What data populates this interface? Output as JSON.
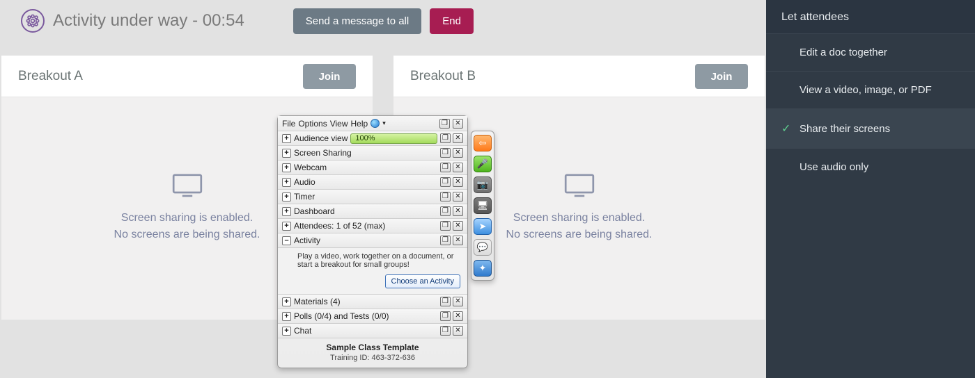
{
  "header": {
    "title": "Activity under way - 00:54",
    "send_all": "Send a message to all",
    "end": "End"
  },
  "breakouts": [
    {
      "name": "Breakout A",
      "join": "Join",
      "line1": "Screen sharing is enabled.",
      "line2": "No screens are being shared."
    },
    {
      "name": "Breakout B",
      "join": "Join",
      "line1": "Screen sharing is enabled.",
      "line2": "No screens are being shared."
    }
  ],
  "sidebar": {
    "title": "Let attendees",
    "items": [
      {
        "label": "Edit a doc together",
        "selected": false
      },
      {
        "label": "View a video, image, or PDF",
        "selected": false
      },
      {
        "label": "Share their screens",
        "selected": true
      },
      {
        "label": "Use audio only",
        "selected": false
      }
    ]
  },
  "panel": {
    "menu": {
      "file": "File",
      "options": "Options",
      "view": "View",
      "help": "Help"
    },
    "rows": {
      "audience": {
        "label": "Audience view",
        "percent": "100%"
      },
      "screen": {
        "label": "Screen Sharing"
      },
      "webcam": {
        "label": "Webcam"
      },
      "audio": {
        "label": "Audio"
      },
      "timer": {
        "label": "Timer"
      },
      "dashboard": {
        "label": "Dashboard"
      },
      "attendees": {
        "label": "Attendees:  1 of 52 (max)"
      },
      "activity": {
        "label": "Activity",
        "desc": "Play a video, work together on a document, or start a breakout for small groups!",
        "choose": "Choose an Activity"
      },
      "materials": {
        "label": "Materials (4)"
      },
      "polls": {
        "label": "Polls (0/4) and Tests (0/0)"
      },
      "chat": {
        "label": "Chat"
      }
    },
    "footer": {
      "title": "Sample Class Template",
      "id": "Training ID: 463-372-636"
    }
  }
}
